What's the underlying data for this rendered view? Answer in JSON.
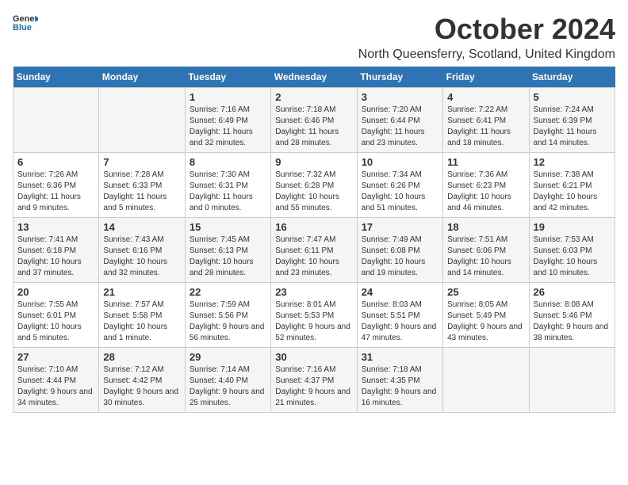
{
  "logo": {
    "general": "General",
    "blue": "Blue"
  },
  "title": "October 2024",
  "subtitle": "North Queensferry, Scotland, United Kingdom",
  "headers": [
    "Sunday",
    "Monday",
    "Tuesday",
    "Wednesday",
    "Thursday",
    "Friday",
    "Saturday"
  ],
  "weeks": [
    [
      {
        "day": "",
        "info": ""
      },
      {
        "day": "",
        "info": ""
      },
      {
        "day": "1",
        "info": "Sunrise: 7:16 AM\nSunset: 6:49 PM\nDaylight: 11 hours and 32 minutes."
      },
      {
        "day": "2",
        "info": "Sunrise: 7:18 AM\nSunset: 6:46 PM\nDaylight: 11 hours and 28 minutes."
      },
      {
        "day": "3",
        "info": "Sunrise: 7:20 AM\nSunset: 6:44 PM\nDaylight: 11 hours and 23 minutes."
      },
      {
        "day": "4",
        "info": "Sunrise: 7:22 AM\nSunset: 6:41 PM\nDaylight: 11 hours and 18 minutes."
      },
      {
        "day": "5",
        "info": "Sunrise: 7:24 AM\nSunset: 6:39 PM\nDaylight: 11 hours and 14 minutes."
      }
    ],
    [
      {
        "day": "6",
        "info": "Sunrise: 7:26 AM\nSunset: 6:36 PM\nDaylight: 11 hours and 9 minutes."
      },
      {
        "day": "7",
        "info": "Sunrise: 7:28 AM\nSunset: 6:33 PM\nDaylight: 11 hours and 5 minutes."
      },
      {
        "day": "8",
        "info": "Sunrise: 7:30 AM\nSunset: 6:31 PM\nDaylight: 11 hours and 0 minutes."
      },
      {
        "day": "9",
        "info": "Sunrise: 7:32 AM\nSunset: 6:28 PM\nDaylight: 10 hours and 55 minutes."
      },
      {
        "day": "10",
        "info": "Sunrise: 7:34 AM\nSunset: 6:26 PM\nDaylight: 10 hours and 51 minutes."
      },
      {
        "day": "11",
        "info": "Sunrise: 7:36 AM\nSunset: 6:23 PM\nDaylight: 10 hours and 46 minutes."
      },
      {
        "day": "12",
        "info": "Sunrise: 7:38 AM\nSunset: 6:21 PM\nDaylight: 10 hours and 42 minutes."
      }
    ],
    [
      {
        "day": "13",
        "info": "Sunrise: 7:41 AM\nSunset: 6:18 PM\nDaylight: 10 hours and 37 minutes."
      },
      {
        "day": "14",
        "info": "Sunrise: 7:43 AM\nSunset: 6:16 PM\nDaylight: 10 hours and 32 minutes."
      },
      {
        "day": "15",
        "info": "Sunrise: 7:45 AM\nSunset: 6:13 PM\nDaylight: 10 hours and 28 minutes."
      },
      {
        "day": "16",
        "info": "Sunrise: 7:47 AM\nSunset: 6:11 PM\nDaylight: 10 hours and 23 minutes."
      },
      {
        "day": "17",
        "info": "Sunrise: 7:49 AM\nSunset: 6:08 PM\nDaylight: 10 hours and 19 minutes."
      },
      {
        "day": "18",
        "info": "Sunrise: 7:51 AM\nSunset: 6:06 PM\nDaylight: 10 hours and 14 minutes."
      },
      {
        "day": "19",
        "info": "Sunrise: 7:53 AM\nSunset: 6:03 PM\nDaylight: 10 hours and 10 minutes."
      }
    ],
    [
      {
        "day": "20",
        "info": "Sunrise: 7:55 AM\nSunset: 6:01 PM\nDaylight: 10 hours and 5 minutes."
      },
      {
        "day": "21",
        "info": "Sunrise: 7:57 AM\nSunset: 5:58 PM\nDaylight: 10 hours and 1 minute."
      },
      {
        "day": "22",
        "info": "Sunrise: 7:59 AM\nSunset: 5:56 PM\nDaylight: 9 hours and 56 minutes."
      },
      {
        "day": "23",
        "info": "Sunrise: 8:01 AM\nSunset: 5:53 PM\nDaylight: 9 hours and 52 minutes."
      },
      {
        "day": "24",
        "info": "Sunrise: 8:03 AM\nSunset: 5:51 PM\nDaylight: 9 hours and 47 minutes."
      },
      {
        "day": "25",
        "info": "Sunrise: 8:05 AM\nSunset: 5:49 PM\nDaylight: 9 hours and 43 minutes."
      },
      {
        "day": "26",
        "info": "Sunrise: 8:08 AM\nSunset: 5:46 PM\nDaylight: 9 hours and 38 minutes."
      }
    ],
    [
      {
        "day": "27",
        "info": "Sunrise: 7:10 AM\nSunset: 4:44 PM\nDaylight: 9 hours and 34 minutes."
      },
      {
        "day": "28",
        "info": "Sunrise: 7:12 AM\nSunset: 4:42 PM\nDaylight: 9 hours and 30 minutes."
      },
      {
        "day": "29",
        "info": "Sunrise: 7:14 AM\nSunset: 4:40 PM\nDaylight: 9 hours and 25 minutes."
      },
      {
        "day": "30",
        "info": "Sunrise: 7:16 AM\nSunset: 4:37 PM\nDaylight: 9 hours and 21 minutes."
      },
      {
        "day": "31",
        "info": "Sunrise: 7:18 AM\nSunset: 4:35 PM\nDaylight: 9 hours and 16 minutes."
      },
      {
        "day": "",
        "info": ""
      },
      {
        "day": "",
        "info": ""
      }
    ]
  ]
}
